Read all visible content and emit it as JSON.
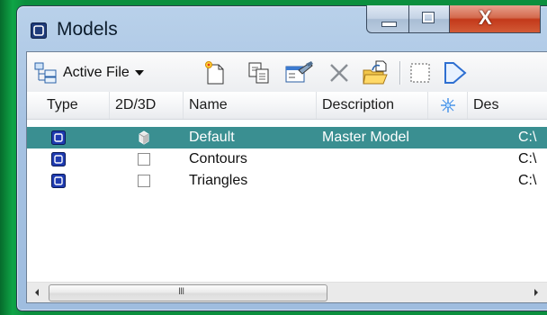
{
  "window": {
    "title": "Models",
    "accent": "#3a8f91",
    "desktop_color": "#0b8f3e"
  },
  "caption": {
    "close_glyph": "X"
  },
  "toolbar": {
    "active_file_label": "Active File",
    "icons": [
      "models-tree-icon",
      "new-model-icon",
      "copy-model-icon",
      "model-properties-icon",
      "delete-icon",
      "import-icon",
      "select-icon",
      "next-icon"
    ]
  },
  "columns": [
    "Type",
    "2D/3D",
    "Name",
    "Description",
    "",
    "Des"
  ],
  "rows": [
    {
      "name": "Default",
      "description": "Master Model",
      "path": "C:\\",
      "dim": "3D",
      "selected": true
    },
    {
      "name": "Contours",
      "description": "",
      "path": "C:\\",
      "dim": "2D",
      "selected": false
    },
    {
      "name": "Triangles",
      "description": "",
      "path": "C:\\",
      "dim": "2D",
      "selected": false
    }
  ],
  "scrollbar": {
    "grip": "III"
  }
}
